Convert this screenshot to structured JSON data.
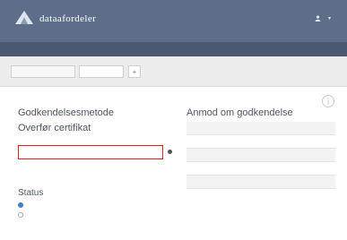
{
  "app": {
    "name": "dataafordeler"
  },
  "user": {
    "label": "",
    "icon": "user-icon"
  },
  "subnav": [
    {
      "label": "",
      "active": false
    },
    {
      "label": "",
      "active": true
    },
    {
      "label": "",
      "active": false
    }
  ],
  "tabs": [
    {
      "label": ""
    },
    {
      "label": ""
    }
  ],
  "left": {
    "method_title": "Godkendelsesmetode",
    "method_value": "",
    "cert_title": "Overfør certifikat",
    "cert_value": "",
    "cert_sub": [
      "",
      ""
    ]
  },
  "status": {
    "title": "Status",
    "options": [
      {
        "label": "",
        "selected": true
      },
      {
        "label": "",
        "selected": false
      }
    ]
  },
  "request": {
    "title": "Anmod om godkendelse",
    "description": "",
    "list_title": "",
    "rows": [
      {
        "name": "",
        "action": ""
      },
      {
        "name": "",
        "action": ""
      },
      {
        "name": "",
        "action": ""
      },
      {
        "name": "",
        "action": ""
      },
      {
        "name": "",
        "action": ""
      }
    ]
  },
  "colors": {
    "header": "#5e6e8a",
    "subnav": "#4a5872",
    "accent": "#3b82c4",
    "error": "#e02020"
  }
}
